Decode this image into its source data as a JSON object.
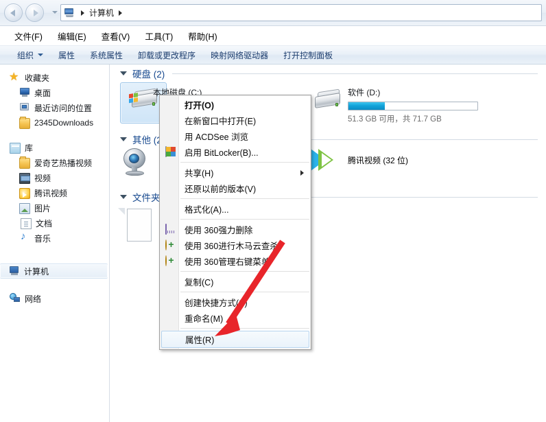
{
  "window": {
    "address": {
      "icon": "computer-icon",
      "crumbs": [
        "计算机"
      ]
    },
    "nav": {
      "back": "后退",
      "forward": "前进",
      "recent_dropdown": "最近浏览的位置"
    }
  },
  "menubar": {
    "items": [
      "文件(F)",
      "编辑(E)",
      "查看(V)",
      "工具(T)",
      "帮助(H)"
    ]
  },
  "commandbar": {
    "items": [
      {
        "label": "组织",
        "has_caret": true
      },
      {
        "label": "属性",
        "has_caret": false
      },
      {
        "label": "系统属性",
        "has_caret": false
      },
      {
        "label": "卸载或更改程序",
        "has_caret": false
      },
      {
        "label": "映射网络驱动器",
        "has_caret": false
      },
      {
        "label": "打开控制面板",
        "has_caret": false
      }
    ]
  },
  "sidebar": {
    "groups": [
      {
        "header": {
          "label": "收藏夹",
          "icon": "star-icon"
        },
        "items": [
          {
            "label": "桌面",
            "icon": "desktop-icon"
          },
          {
            "label": "最近访问的位置",
            "icon": "recent-places-icon"
          },
          {
            "label": "2345Downloads",
            "icon": "folder-icon"
          }
        ]
      },
      {
        "header": {
          "label": "库",
          "icon": "library-icon"
        },
        "items": [
          {
            "label": "爱奇艺热播视频",
            "icon": "folder-icon"
          },
          {
            "label": "视频",
            "icon": "video-library-icon"
          },
          {
            "label": "腾讯视频",
            "icon": "tencent-video-folder-icon"
          },
          {
            "label": "图片",
            "icon": "pictures-library-icon"
          },
          {
            "label": "文档",
            "icon": "documents-library-icon"
          },
          {
            "label": "音乐",
            "icon": "music-library-icon"
          }
        ]
      },
      {
        "header": {
          "label": "计算机",
          "icon": "computer-icon",
          "selected": true
        },
        "items": []
      },
      {
        "header": {
          "label": "网络",
          "icon": "network-icon"
        },
        "items": []
      }
    ]
  },
  "content": {
    "groups": [
      {
        "title": "硬盘 (2)",
        "tiles": [
          {
            "name": "本地磁盘 (C:)",
            "icon": "hard-drive-windows-icon",
            "selected": true,
            "capacity_text": "",
            "bar_percent": 0
          },
          {
            "name": "软件 (D:)",
            "icon": "hard-drive-icon",
            "selected": false,
            "capacity_text": "51.3 GB 可用，共 71.7 GB",
            "bar_percent": 28
          }
        ]
      },
      {
        "title": "其他 (2)",
        "tiles": [
          {
            "name": "",
            "icon": "webcam-icon",
            "selected": false,
            "capacity_text": "",
            "bar_percent": 0
          },
          {
            "name": "腾讯视频 (32 位)",
            "icon": "tencent-video-icon",
            "selected": false,
            "capacity_text": "",
            "bar_percent": 0
          }
        ]
      },
      {
        "title": "文件夹",
        "tiles": [
          {
            "name": "",
            "icon": "blank-file-icon",
            "selected": false,
            "capacity_text": "",
            "bar_percent": 0
          }
        ]
      }
    ]
  },
  "context_menu": {
    "items": [
      {
        "label": "打开(O)",
        "bold": true,
        "icon": null,
        "submenu": false,
        "hovered": false
      },
      {
        "label": "在新窗口中打开(E)",
        "bold": false,
        "icon": null,
        "submenu": false,
        "hovered": false
      },
      {
        "label": "用 ACDSee 浏览",
        "bold": false,
        "icon": null,
        "submenu": false,
        "hovered": false
      },
      {
        "label": "启用 BitLocker(B)...",
        "bold": false,
        "icon": "uac-shield-icon",
        "submenu": false,
        "hovered": false
      },
      {
        "separator": true
      },
      {
        "label": "共享(H)",
        "bold": false,
        "icon": null,
        "submenu": true,
        "hovered": false
      },
      {
        "label": "还原以前的版本(V)",
        "bold": false,
        "icon": null,
        "submenu": false,
        "hovered": false
      },
      {
        "separator": true
      },
      {
        "label": "格式化(A)...",
        "bold": false,
        "icon": null,
        "submenu": false,
        "hovered": false
      },
      {
        "separator": true
      },
      {
        "label": "使用 360强力删除",
        "bold": false,
        "icon": "shredder-icon",
        "submenu": false,
        "hovered": false
      },
      {
        "label": "使用 360进行木马云查杀",
        "bold": false,
        "icon": "360-green-icon",
        "submenu": false,
        "hovered": false
      },
      {
        "label": "使用 360管理右键菜单",
        "bold": false,
        "icon": "360-green-icon",
        "submenu": false,
        "hovered": false
      },
      {
        "separator": true
      },
      {
        "label": "复制(C)",
        "bold": false,
        "icon": null,
        "submenu": false,
        "hovered": false
      },
      {
        "separator": true
      },
      {
        "label": "创建快捷方式(S)",
        "bold": false,
        "icon": null,
        "submenu": false,
        "hovered": false
      },
      {
        "label": "重命名(M)",
        "bold": false,
        "icon": null,
        "submenu": false,
        "hovered": false
      },
      {
        "separator": true
      },
      {
        "label": "属性(R)",
        "bold": false,
        "icon": null,
        "submenu": false,
        "hovered": true
      }
    ]
  },
  "annotation": {
    "arrow_color": "#e8252a",
    "points_to": "属性(R)"
  }
}
